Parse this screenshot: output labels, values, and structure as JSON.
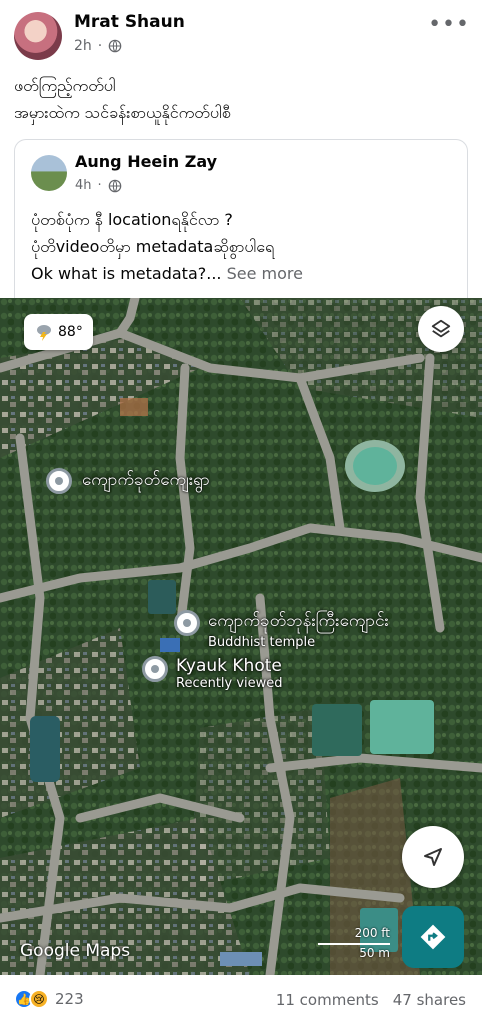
{
  "post": {
    "author": "Mrat Shaun",
    "time": "2h",
    "text_lines": [
      "ဖတ်ကြည့်ကတ်ပါ",
      "အမှားထဲက သင်ခန်းစာယူနိုင်ကတ်ပါစီ"
    ]
  },
  "shared_post": {
    "author": "Aung Heein Zay",
    "time": "4h",
    "line1": "ပုံတစ်ပုံက နီ locationရနိုင်လာ ?",
    "line2": "ပုံတိvideoတိမှာ metadataဆိုစွာပါရေ",
    "line3": "Ok  what is metadata?...",
    "see_more": "See more"
  },
  "map": {
    "weather_icon": "thunderstorm-icon",
    "temperature": "88°",
    "place_village": "ကျောက်ခုတ်ကျေးရွာ",
    "place_temple": "ကျောက်ခုတ်ဘုန်းကြီးကျောင်း",
    "place_temple_type": "Buddhist temple",
    "place_selected": "Kyauk Khote",
    "place_selected_sub": "Recently viewed",
    "attribution": "Google Maps",
    "scale_ft": "200 ft",
    "scale_m": "50 m",
    "colors": {
      "directions": "#0e7c83",
      "vegetation": "#2f4a2e",
      "road": "#9a9a92",
      "pond": "#5fb39b"
    }
  },
  "footer": {
    "reaction_count": "223",
    "comments": "11 comments",
    "shares": "47 shares"
  }
}
